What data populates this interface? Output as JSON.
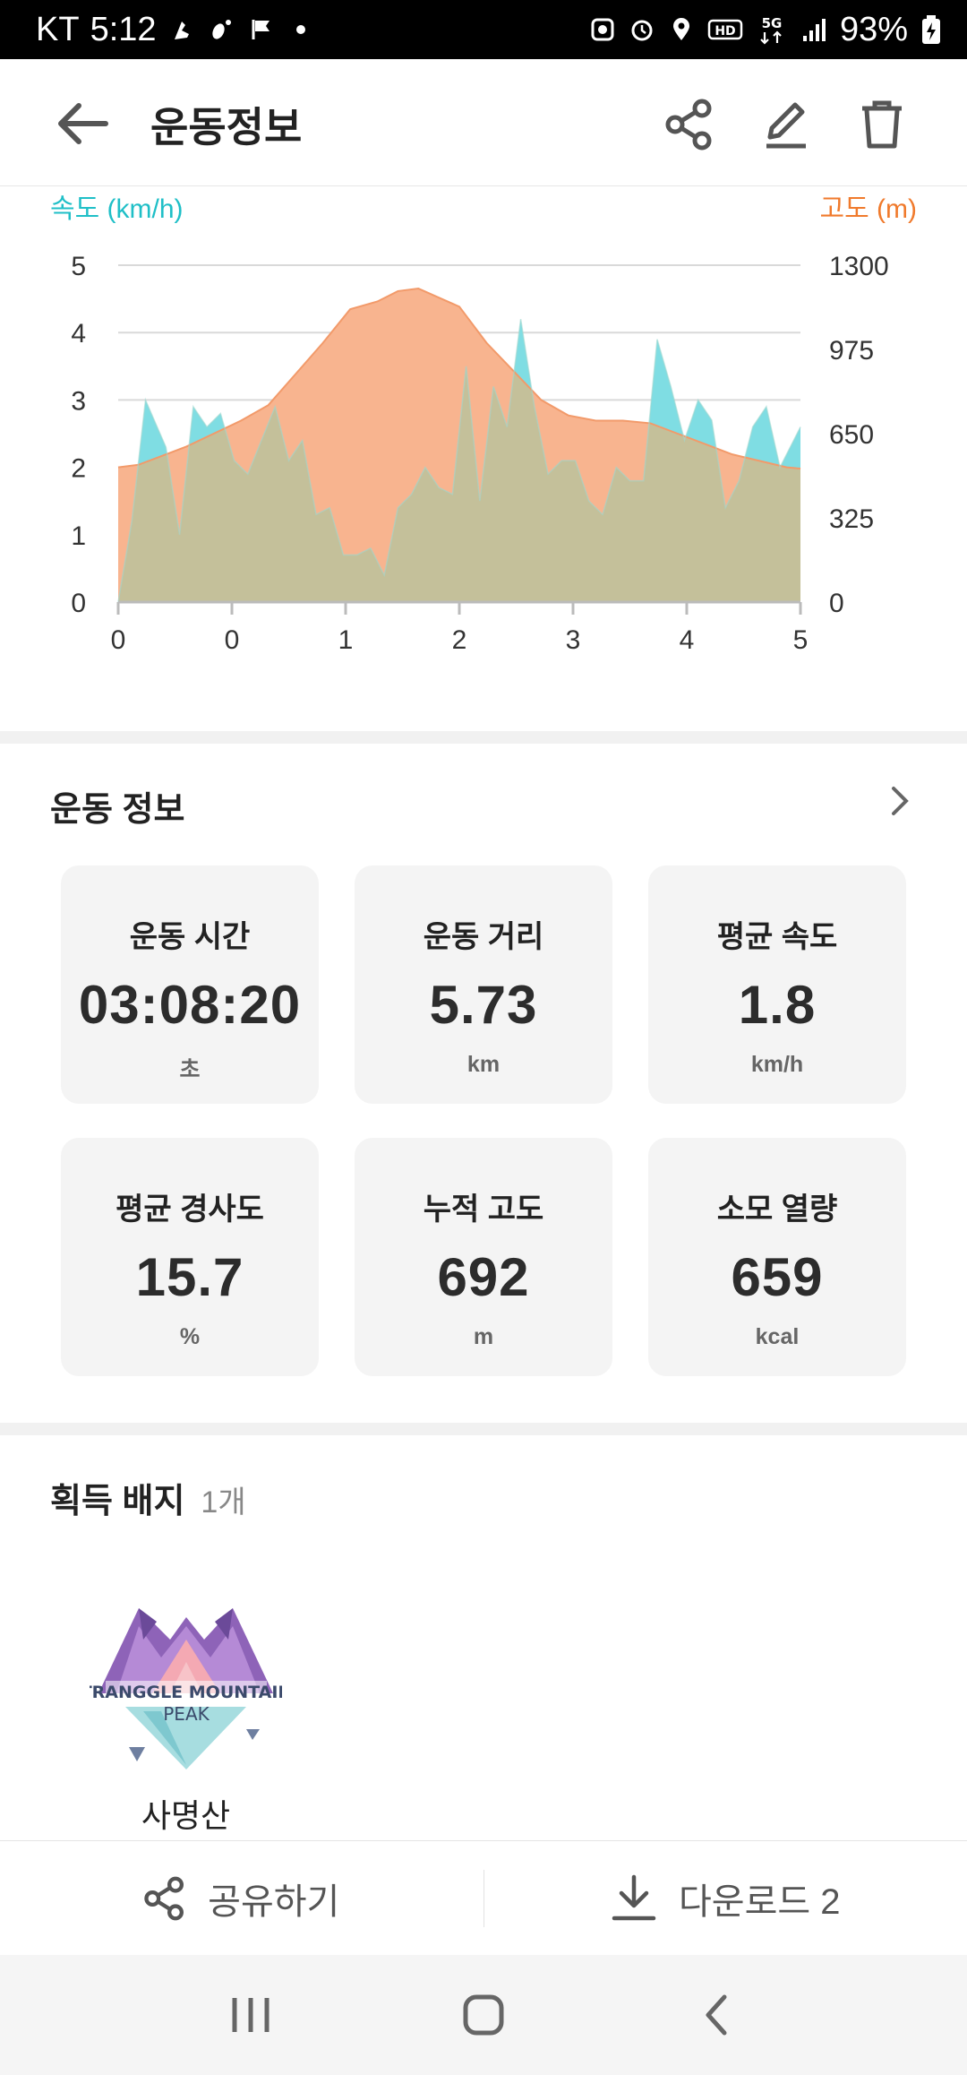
{
  "status_bar": {
    "carrier": "KT",
    "time": "5:12",
    "battery": "93%",
    "network": "5G"
  },
  "appbar": {
    "title": "운동정보",
    "icons": [
      "back-arrow-icon",
      "share-icon",
      "edit-icon",
      "delete-icon"
    ]
  },
  "chart_data": {
    "type": "area",
    "left_axis_label": "속도 (km/h)",
    "right_axis_label": "고도 (m)",
    "x_ticks": [
      "0",
      "0",
      "1",
      "2",
      "3",
      "4",
      "5"
    ],
    "y_left_ticks": [
      "0",
      "1",
      "2",
      "3",
      "4",
      "5"
    ],
    "y_right_ticks": [
      "0",
      "325",
      "650",
      "975",
      "1300"
    ],
    "ylim_left": [
      0,
      5
    ],
    "ylim_right": [
      0,
      1300
    ],
    "xlim": [
      0,
      5
    ],
    "grid": true,
    "colors": {
      "speed": "#7fdde3",
      "altitude": "#f8b48f",
      "overlap": "#c4c09a",
      "left_axis": "#1fbfc7",
      "right_axis": "#f07a2c"
    },
    "series": [
      {
        "key": "speed",
        "x": [
          0,
          0.1,
          0.2,
          0.35,
          0.45,
          0.55,
          0.65,
          0.75,
          0.85,
          0.95,
          1.05,
          1.15,
          1.25,
          1.35,
          1.45,
          1.55,
          1.65,
          1.75,
          1.85,
          1.95,
          2.05,
          2.15,
          2.25,
          2.35,
          2.45,
          2.55,
          2.65,
          2.75,
          2.85,
          2.95,
          3.05,
          3.15,
          3.25,
          3.35,
          3.45,
          3.55,
          3.65,
          3.75,
          3.85,
          3.95,
          4.05,
          4.15,
          4.25,
          4.35,
          4.45,
          4.55,
          4.65,
          4.75,
          4.85,
          5.0
        ],
        "values": [
          0,
          1.2,
          3.0,
          2.3,
          1.0,
          2.9,
          2.6,
          2.8,
          2.1,
          1.9,
          2.4,
          2.9,
          2.1,
          2.4,
          1.3,
          1.4,
          0.7,
          0.7,
          0.8,
          0.4,
          1.4,
          1.6,
          2.0,
          1.7,
          1.6,
          3.5,
          1.5,
          3.2,
          2.6,
          4.2,
          2.9,
          1.9,
          2.1,
          2.1,
          1.5,
          1.3,
          2.0,
          1.8,
          1.8,
          3.9,
          3.2,
          2.4,
          3.0,
          2.7,
          1.4,
          1.8,
          2.6,
          2.9,
          2.0,
          2.6
        ]
      },
      {
        "key": "altitude",
        "x": [
          0,
          0.15,
          0.3,
          0.5,
          0.7,
          0.9,
          1.1,
          1.3,
          1.5,
          1.7,
          1.9,
          2.05,
          2.2,
          2.35,
          2.5,
          2.7,
          2.9,
          3.1,
          3.3,
          3.5,
          3.7,
          3.9,
          4.1,
          4.3,
          4.5,
          4.7,
          4.9,
          5.0
        ],
        "values": [
          520,
          530,
          560,
          600,
          650,
          700,
          760,
          880,
          1000,
          1130,
          1160,
          1200,
          1210,
          1175,
          1140,
          1000,
          890,
          780,
          720,
          700,
          700,
          690,
          650,
          610,
          570,
          545,
          520,
          515
        ]
      }
    ]
  },
  "exercise_section": {
    "title": "운동 정보",
    "cards": [
      {
        "label": "운동 시간",
        "value": "03:08:20",
        "unit": "초"
      },
      {
        "label": "운동 거리",
        "value": "5.73",
        "unit": "km"
      },
      {
        "label": "평균 속도",
        "value": "1.8",
        "unit": "km/h"
      },
      {
        "label": "평균 경사도",
        "value": "15.7",
        "unit": "%"
      },
      {
        "label": "누적 고도",
        "value": "692",
        "unit": "m"
      },
      {
        "label": "소모 열량",
        "value": "659",
        "unit": "kcal"
      }
    ]
  },
  "badges": {
    "title": "획득 배지",
    "count": "1개",
    "items": [
      {
        "name": "사명산",
        "logo_text_1": "TRANGGLE MOUNTAIN",
        "logo_text_2": "PEAK"
      }
    ]
  },
  "bottom_actions": {
    "share_label": "공유하기",
    "download_label": "다운로드 2"
  }
}
